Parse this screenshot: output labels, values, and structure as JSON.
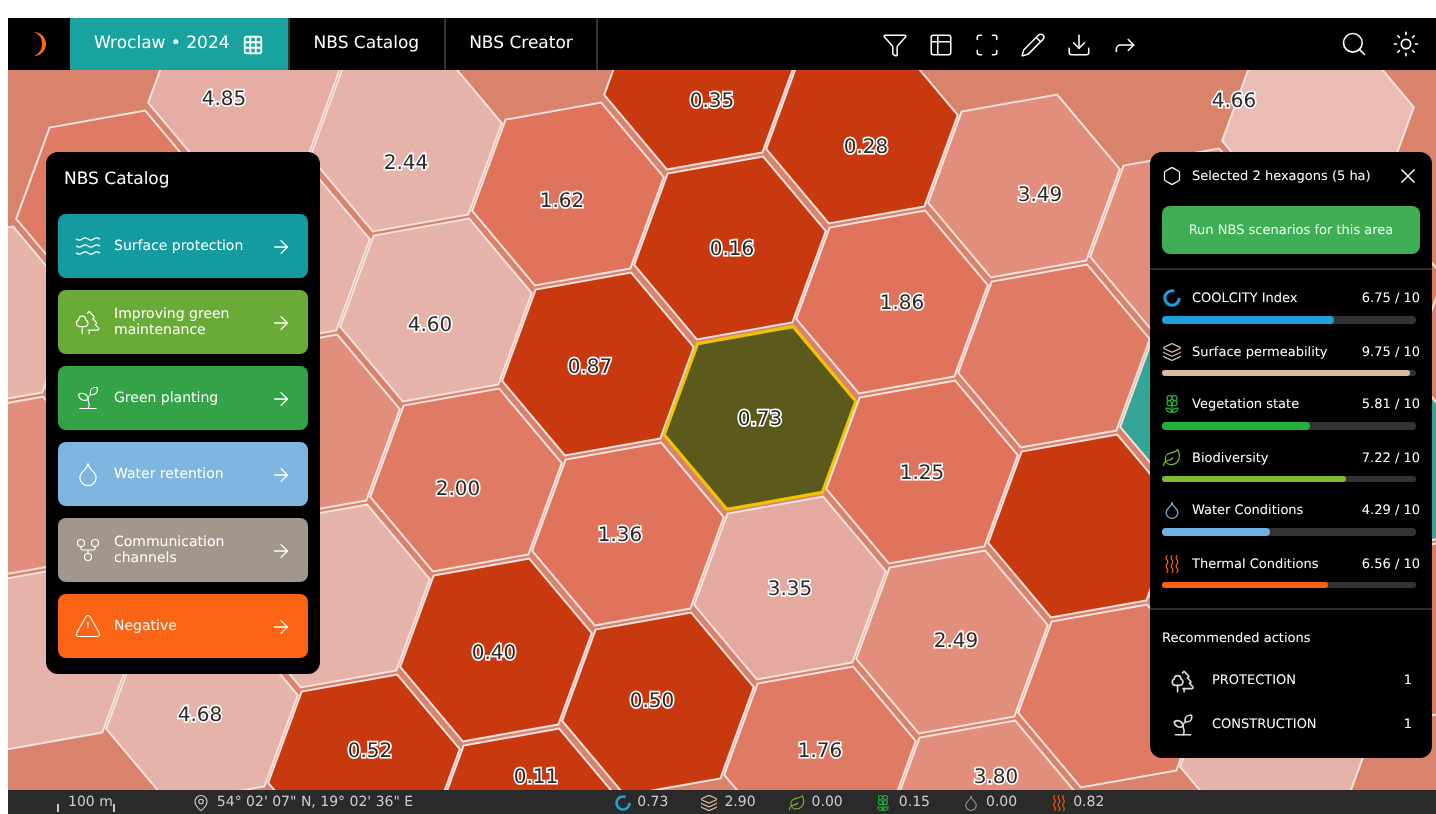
{
  "header": {
    "tabs": [
      {
        "label": "Wroclaw • 2024",
        "selected": true
      },
      {
        "label": "NBS Catalog",
        "selected": false
      },
      {
        "label": "NBS Creator",
        "selected": false
      }
    ]
  },
  "map": {
    "hexagons": [
      {
        "value": "4.85",
        "color": "#e5ada3",
        "selected": false
      },
      {
        "value": "0.35",
        "color": "#c8390f",
        "selected": false
      },
      {
        "value": "0.28",
        "color": "#c8390f",
        "selected": false
      },
      {
        "value": "4.66",
        "color": "#e9bdb4",
        "selected": false
      },
      {
        "value": "2.44",
        "color": "#e6b3aa",
        "selected": false
      },
      {
        "value": "1.62",
        "color": "#df735c",
        "selected": false
      },
      {
        "value": "3.49",
        "color": "#e28e7c",
        "selected": false
      },
      {
        "value": "0.16",
        "color": "#c8390f",
        "selected": false
      },
      {
        "value": "4.60",
        "color": "#e6b3aa",
        "selected": false
      },
      {
        "value": "0.87",
        "color": "#c8390f",
        "selected": false
      },
      {
        "value": "1.86",
        "color": "#df735c",
        "selected": false
      },
      {
        "value": "0.73",
        "color": "#5b5a1c",
        "selected": true
      },
      {
        "value": "2.00",
        "color": "#df7a64",
        "selected": false
      },
      {
        "value": "1.36",
        "color": "#df735c",
        "selected": false
      },
      {
        "value": "1.25",
        "color": "#df735c",
        "selected": false
      },
      {
        "value": "3.35",
        "color": "#e4aaa0",
        "selected": false
      },
      {
        "value": "2.49",
        "color": "#e28e7c",
        "selected": false
      },
      {
        "value": "0.40",
        "color": "#c8390f",
        "selected": false
      },
      {
        "value": "0.50",
        "color": "#c8390f",
        "selected": false
      },
      {
        "value": "4.68",
        "color": "#e6b3aa",
        "selected": false
      },
      {
        "value": "0.52",
        "color": "#c8390f",
        "selected": false
      },
      {
        "value": "1.76",
        "color": "#df7a64",
        "selected": false
      },
      {
        "value": "0.11",
        "color": "#c8390f",
        "selected": false
      },
      {
        "value": "3.80",
        "color": "#e28e7c",
        "selected": false
      }
    ]
  },
  "catalog": {
    "title": "NBS Catalog",
    "items": [
      {
        "label": "Surface protection",
        "color": "#149ba0"
      },
      {
        "label": "Improving green maintenance",
        "color": "#6aaa36"
      },
      {
        "label": "Green planting",
        "color": "#34a347"
      },
      {
        "label": "Water retention",
        "color": "#7fb6e0"
      },
      {
        "label": "Communication channels",
        "color": "#a3978c"
      },
      {
        "label": "Negative",
        "color": "#fa6414"
      }
    ]
  },
  "selection": {
    "title": "Selected 2 hexagons (5 ha)",
    "button": "Run NBS scenarios for this area",
    "metrics": [
      {
        "kind": "ring",
        "name": "COOLCITY Index",
        "value": "6.75 / 10",
        "level": 0.675,
        "color": "#1ea0dc"
      },
      {
        "kind": "permeability",
        "name": "Surface permeability",
        "value": "9.75 / 10",
        "level": 0.975,
        "color": "#d9b9a3"
      },
      {
        "kind": "vegetation",
        "name": "Vegetation state",
        "value": "5.81 / 10",
        "level": 0.581,
        "color": "#22b23a"
      },
      {
        "kind": "leaf",
        "name": "Biodiversity",
        "value": "7.22 / 10",
        "level": 0.722,
        "color": "#7cba2e"
      },
      {
        "kind": "drop",
        "name": "Water Conditions",
        "value": "4.29 / 10",
        "level": 0.429,
        "color": "#6fb1e6"
      },
      {
        "kind": "heat",
        "name": "Thermal Conditions",
        "value": "6.56 / 10",
        "level": 0.656,
        "color": "#fb5e14"
      }
    ],
    "actions_title": "Recommended actions",
    "actions": [
      {
        "kind": "protection",
        "label": "PROTECTION",
        "count": "1"
      },
      {
        "kind": "construction",
        "label": "CONSTRUCTION",
        "count": "1"
      }
    ]
  },
  "status_bar": {
    "scale": "100 m",
    "coordinates": "54° 02' 07\" N, 19° 02' 36\" E",
    "readings": [
      {
        "kind": "ring",
        "value": "0.73"
      },
      {
        "kind": "permeability",
        "value": "2.90"
      },
      {
        "kind": "leaf",
        "value": "0.00"
      },
      {
        "kind": "vegetation",
        "value": "0.15"
      },
      {
        "kind": "drop",
        "value": "0.00"
      },
      {
        "kind": "heat",
        "value": "0.82"
      }
    ]
  }
}
